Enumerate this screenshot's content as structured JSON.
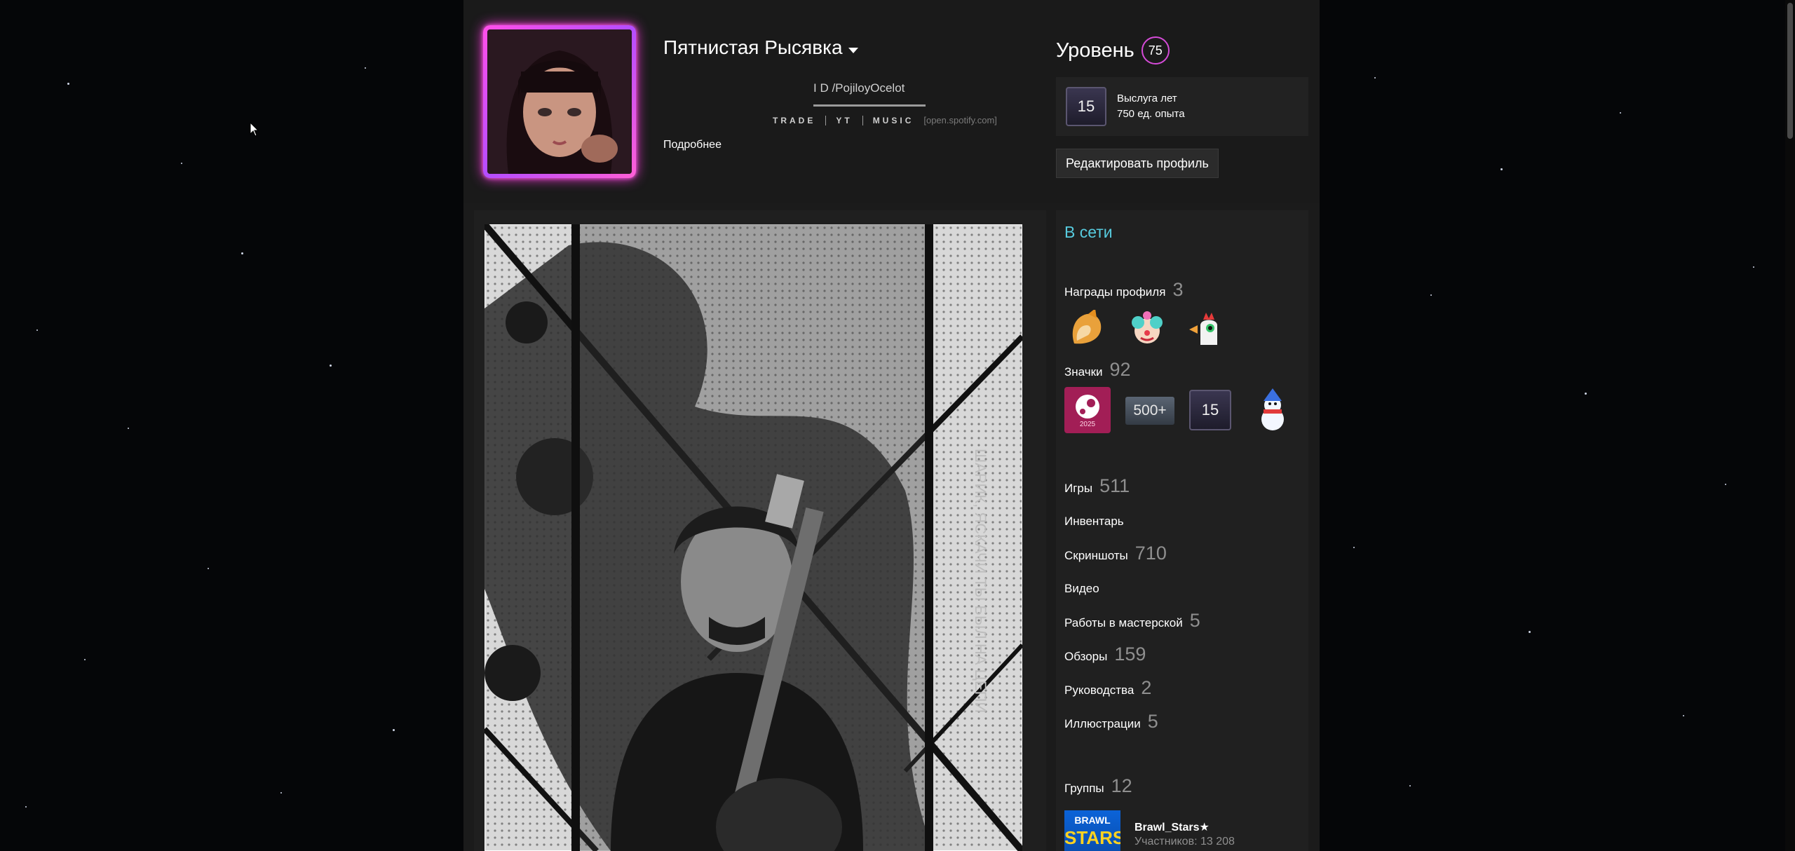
{
  "profile": {
    "persona_name": "Пятнистая Рысявка",
    "id_line": "I D /PojiloyOcelot",
    "tagline": [
      "TRADE",
      "YT",
      "MUSIC"
    ],
    "tagline_url": "[open.spotify.com]",
    "more_link": "Подробнее"
  },
  "level": {
    "label": "Уровень",
    "value": "75",
    "xp_badge_number": "15",
    "xp_title": "Выслуга лет",
    "xp_points": "750 ед. опыта",
    "edit_button": "Редактировать профиль"
  },
  "sidebar": {
    "status": "В сети",
    "awards": {
      "label": "Награды профиля",
      "count": "3"
    },
    "badges": {
      "label": "Значки",
      "count": "92",
      "badge_500": "500+",
      "badge_15": "15",
      "badge_2025": "2025"
    },
    "stats": [
      {
        "label": "Игры",
        "count": "511"
      },
      {
        "label": "Инвентарь",
        "count": ""
      },
      {
        "label": "Скриншоты",
        "count": "710"
      },
      {
        "label": "Видео",
        "count": ""
      },
      {
        "label": "Работы в мастерской",
        "count": "5"
      },
      {
        "label": "Обзоры",
        "count": "159"
      },
      {
        "label": "Руководства",
        "count": "2"
      },
      {
        "label": "Иллюстрации",
        "count": "5"
      }
    ],
    "groups": {
      "label": "Группы",
      "count": "12"
    },
    "group_item": {
      "logo_top": "BRAWL",
      "logo_bottom": "STARS",
      "name": "Brawl_Stars★",
      "members": "Участников: 13 208"
    }
  },
  "artwork": {
    "vertical_text": "ШАРИК, ЯСКАЧИ ТЫ БЫЛ НА ЦЕПИ"
  },
  "colors": {
    "page_bg": "#050608",
    "column_bg": "#1b1b1b",
    "online": "#57cbde",
    "avatar_glow": "#ff39e0",
    "level_ring": "#d54bd8"
  }
}
